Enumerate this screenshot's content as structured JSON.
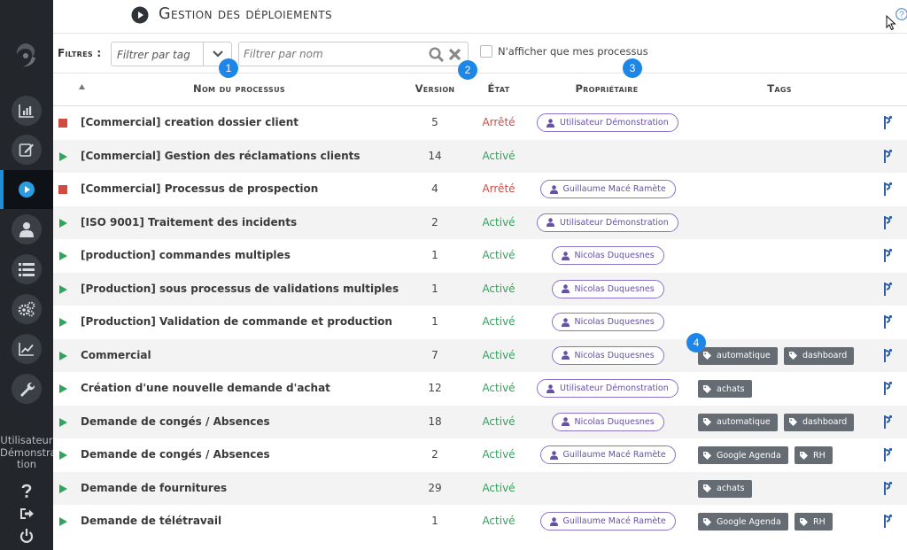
{
  "header": {
    "title": "Gestion des déploiements"
  },
  "sidebar": {
    "user_line1": "Utilisateur",
    "user_line2": "Démonstra",
    "user_line3": "tion",
    "items": [
      {
        "icon": "bar-chart-icon"
      },
      {
        "icon": "edit-icon"
      },
      {
        "icon": "play-icon",
        "active": true
      },
      {
        "icon": "user-icon"
      },
      {
        "icon": "list-icon"
      },
      {
        "icon": "gears-icon"
      },
      {
        "icon": "line-chart-icon"
      },
      {
        "icon": "wrench-icon"
      }
    ]
  },
  "filters": {
    "label": "Filtres :",
    "tag_placeholder": "Filtrer par tag",
    "name_placeholder": "Filtrer par nom",
    "only_mine_label": "N'afficher que mes processus"
  },
  "badges": [
    "1",
    "2",
    "3",
    "4"
  ],
  "columns": {
    "name": "Nom du processus",
    "version": "Version",
    "state": "État",
    "owner": "Propriétaire",
    "tags": "Tags"
  },
  "colors": {
    "accent": "#1e86e6",
    "active": "#2ea55a",
    "stopped": "#d14b43",
    "owner": "#6650a8",
    "tag": "#666c73"
  },
  "rows": [
    {
      "status": "stopped",
      "name": "[Commercial] creation dossier client",
      "version": "5",
      "state": "Arrêté",
      "owner": "Utilisateur Démonstration",
      "tags": []
    },
    {
      "status": "active",
      "name": "[Commercial] Gestion des réclamations clients",
      "version": "14",
      "state": "Activé",
      "owner": "",
      "tags": []
    },
    {
      "status": "stopped",
      "name": "[Commercial] Processus de prospection",
      "version": "4",
      "state": "Arrêté",
      "owner": "Guillaume Macé Ramète",
      "tags": []
    },
    {
      "status": "active",
      "name": "[ISO 9001] Traitement des incidents",
      "version": "2",
      "state": "Activé",
      "owner": "Utilisateur Démonstration",
      "tags": []
    },
    {
      "status": "active",
      "name": "[production] commandes multiples",
      "version": "1",
      "state": "Activé",
      "owner": "Nicolas Duquesnes",
      "tags": []
    },
    {
      "status": "active",
      "name": "[Production] sous processus de validations multiples",
      "version": "1",
      "state": "Activé",
      "owner": "Nicolas Duquesnes",
      "tags": []
    },
    {
      "status": "active",
      "name": "[Production] Validation de commande et production",
      "version": "1",
      "state": "Activé",
      "owner": "Nicolas Duquesnes",
      "tags": []
    },
    {
      "status": "active",
      "name": "Commercial",
      "version": "7",
      "state": "Activé",
      "owner": "Nicolas Duquesnes",
      "tags": [
        "automatique",
        "dashboard"
      ]
    },
    {
      "status": "active",
      "name": "Création d'une nouvelle demande d'achat",
      "version": "12",
      "state": "Activé",
      "owner": "Utilisateur Démonstration",
      "tags": [
        "achats"
      ]
    },
    {
      "status": "active",
      "name": "Demande de congés / Absences",
      "version": "18",
      "state": "Activé",
      "owner": "Nicolas Duquesnes",
      "tags": [
        "automatique",
        "dashboard"
      ]
    },
    {
      "status": "active",
      "name": "Demande de congés / Absences",
      "version": "2",
      "state": "Activé",
      "owner": "Guillaume Macé Ramète",
      "tags": [
        "Google Agenda",
        "RH"
      ]
    },
    {
      "status": "active",
      "name": "Demande de fournitures",
      "version": "29",
      "state": "Activé",
      "owner": "",
      "tags": [
        "achats"
      ]
    },
    {
      "status": "active",
      "name": "Demande de télétravail",
      "version": "1",
      "state": "Activé",
      "owner": "Guillaume Macé Ramète",
      "tags": [
        "Google Agenda",
        "RH"
      ]
    }
  ]
}
